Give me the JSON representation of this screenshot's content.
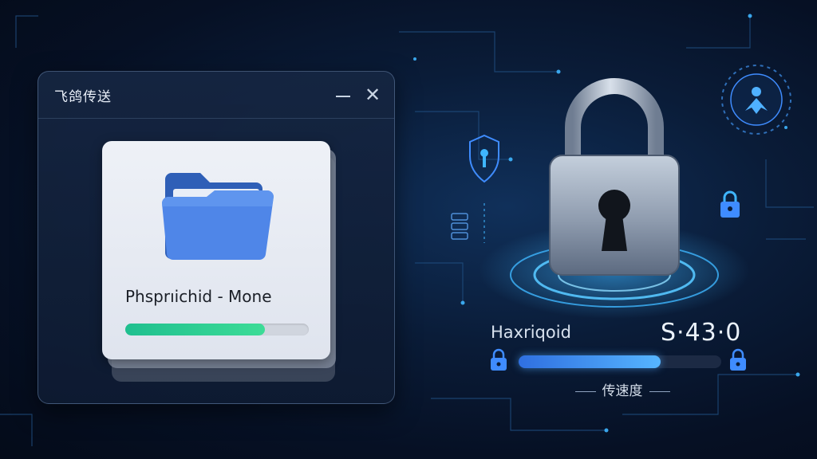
{
  "window": {
    "title": "飞鸽传送",
    "minimize_icon": "minimize-icon",
    "close_icon": "close-icon"
  },
  "file_card": {
    "icon": "folder-icon",
    "name": "Phsprıichid - Mone",
    "progress": 0.76
  },
  "transfer_panel": {
    "label": "Haxriqoid",
    "value": "S·43·0",
    "speed_progress": 0.7,
    "caption": "传速度",
    "icons": [
      "padlock-icon",
      "shield-icon",
      "small-lock-icon",
      "server-icon"
    ]
  },
  "colors": {
    "accent_blue": "#3f8cff",
    "progress_green": "#2fd596",
    "glow_cyan": "#3fb6ff"
  }
}
